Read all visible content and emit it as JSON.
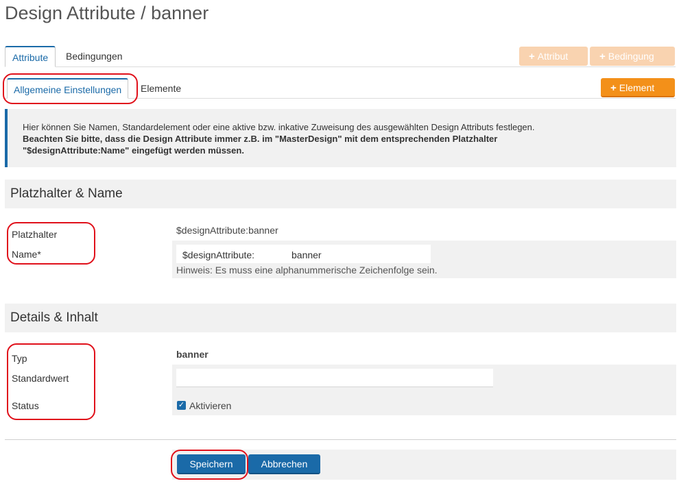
{
  "page": {
    "title": "Design Attribute / banner"
  },
  "tabs": [
    "Attribute",
    "Bedingungen"
  ],
  "toolbar": {
    "attribut_label": "Attribut",
    "bedingung_label": "Bedingung"
  },
  "subtabs": [
    "Allgemeine Einstellungen",
    "Elemente"
  ],
  "element_button": "Element",
  "info": {
    "line1": "Hier können Sie Namen, Standardelement oder eine aktive bzw. inkative Zuweisung des ausgewählten Design Attributs festlegen.",
    "line2": "Beachten Sie bitte, dass die Design Attribute immer z.B. im \"MasterDesign\" mit dem entsprechenden Platzhalter",
    "line3": "\"$designAttribute:Name\" eingefügt werden müssen."
  },
  "section1": {
    "title": "Platzhalter & Name",
    "placeholder_label": "Platzhalter",
    "placeholder_value": "$designAttribute:banner",
    "name_label": "Name*",
    "name_prefix": "$designAttribute:",
    "name_value": "banner",
    "hint": "Hinweis: Es muss eine alphanummerische Zeichenfolge sein."
  },
  "section2": {
    "title": "Details & Inhalt",
    "typ_label": "Typ",
    "typ_value": "banner",
    "standardwert_label": "Standardwert",
    "standardwert_value": "",
    "status_label": "Status",
    "status_checkbox_label": "Aktivieren",
    "status_checked": true
  },
  "actions": {
    "save_label": "Speichern",
    "cancel_label": "Abbrechen"
  },
  "colors": {
    "accent": "#1a6aa8",
    "orange": "#f39019",
    "annotation": "#e0101a"
  },
  "icons": [
    "plus-icon",
    "check-icon"
  ]
}
